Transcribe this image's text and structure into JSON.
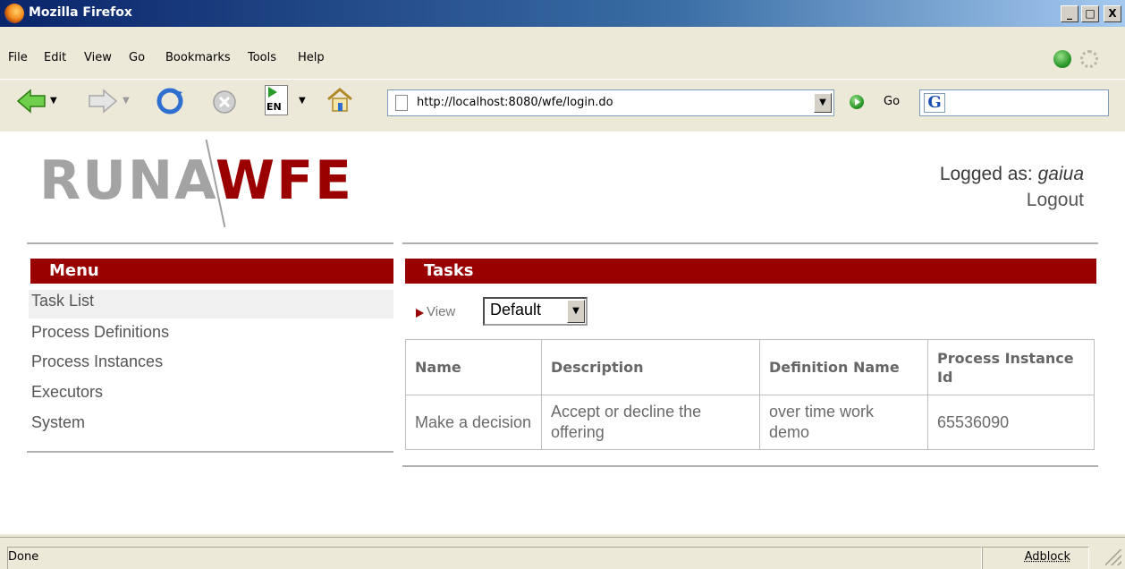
{
  "window": {
    "title": "Mozilla Firefox",
    "minimize": "_",
    "maximize": "□",
    "close": "X"
  },
  "menubar": {
    "items": [
      "File",
      "Edit",
      "View",
      "Go",
      "Bookmarks",
      "Tools",
      "Help"
    ]
  },
  "toolbar": {
    "url": "http://localhost:8080/wfe/login.do",
    "go_label": "Go",
    "search_engine_glyph": "G",
    "icons": [
      "back-icon",
      "forward-icon",
      "reload-icon",
      "stop-icon",
      "translate-icon",
      "home-icon"
    ],
    "translate_label": "EN"
  },
  "page": {
    "logo_left": "RUNA",
    "logo_right": "WFE",
    "logged_as_label": "Logged as:",
    "username": "gaiua",
    "logout": "Logout",
    "menu": {
      "title": "Menu",
      "items": [
        "Task List",
        "Process Definitions",
        "Process Instances",
        "Executors",
        "System"
      ]
    },
    "tasks": {
      "title": "Tasks",
      "view_label": "View",
      "view_value": "Default",
      "columns": [
        "Name",
        "Description",
        "Definition Name",
        "Process Instance Id"
      ],
      "rows": [
        [
          "Make a decision",
          "Accept or decline the offering",
          "over time work demo",
          "65536090"
        ]
      ]
    }
  },
  "status": {
    "text": "Done",
    "addon": "Adblock"
  },
  "colors": {
    "accent": "#990000",
    "logo_grey": "#a3a3a3"
  }
}
